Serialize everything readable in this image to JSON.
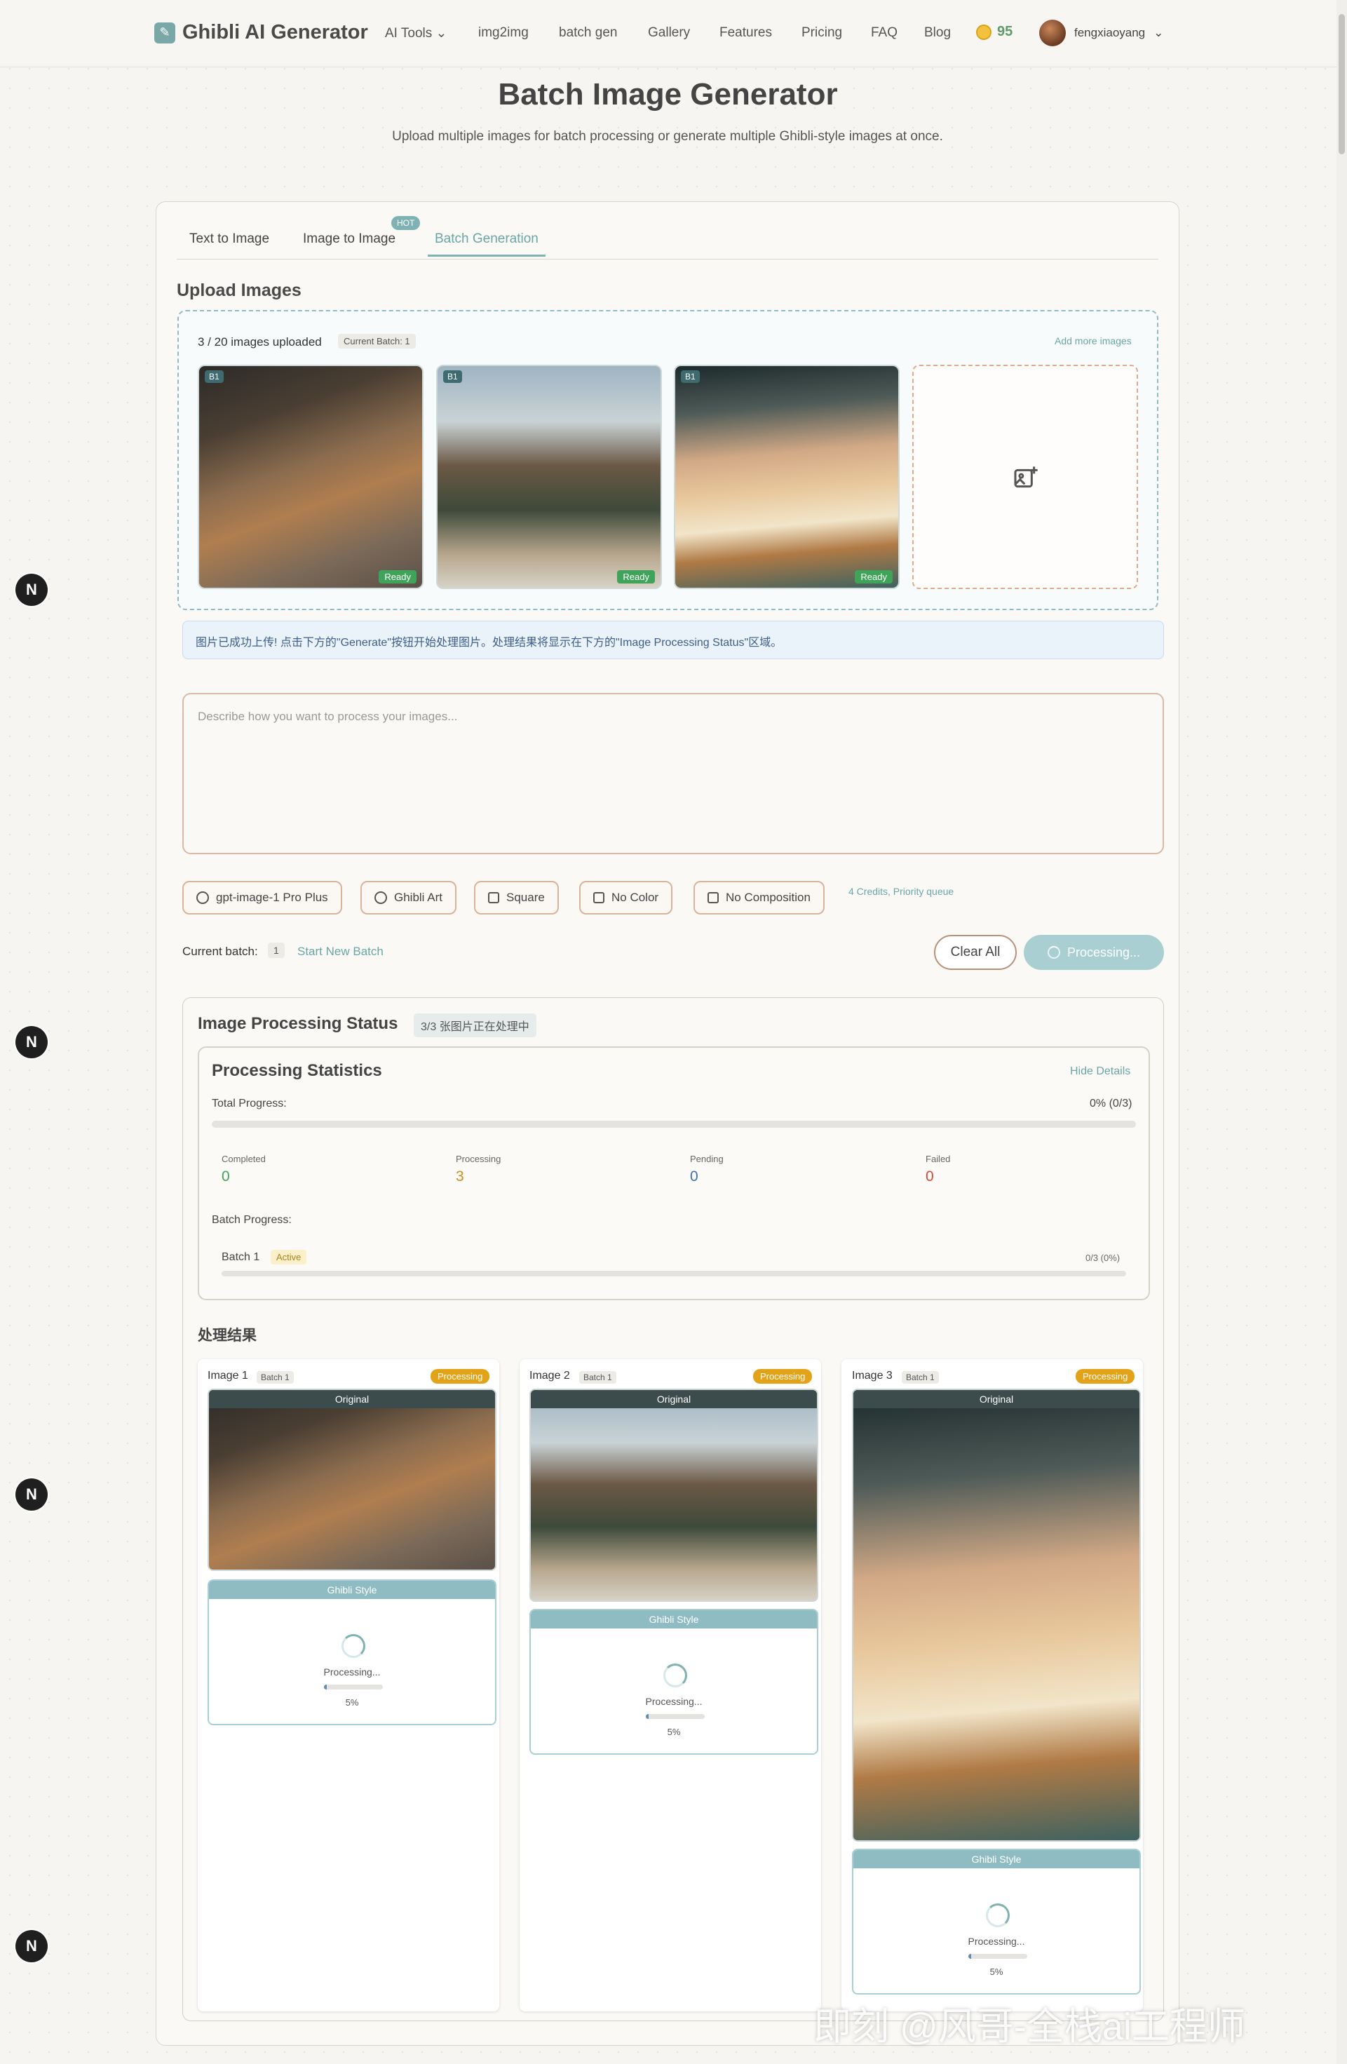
{
  "nav": {
    "logo_text": "Ghibli AI Generator",
    "links": [
      "AI Tools",
      "img2img",
      "batch gen",
      "Gallery",
      "Features",
      "Pricing",
      "FAQ",
      "Blog"
    ],
    "credits": "95",
    "username": "fengxiaoyang"
  },
  "header": {
    "title": "Batch Image Generator",
    "subtitle": "Upload multiple images for batch processing or generate multiple Ghibli-style images at once."
  },
  "tabs": {
    "items": [
      "Text to Image",
      "Image to Image",
      "Batch Generation"
    ],
    "hot_badge": "HOT",
    "active": "Batch Generation"
  },
  "upload": {
    "heading": "Upload Images",
    "count_text": "3 / 20 images uploaded",
    "batch_chip": "Current Batch: 1",
    "add_more": "Add more images",
    "thumb_badge": "B1",
    "thumb_status": "Ready"
  },
  "notice": "图片已成功上传! 点击下方的\"Generate\"按钮开始处理图片。处理结果将显示在下方的\"Image Processing Status\"区域。",
  "prompt": {
    "placeholder": "Describe how you want to process your images..."
  },
  "options": {
    "model": "gpt-image-1 Pro Plus",
    "style": "Ghibli Art",
    "ratio": "Square",
    "color": "No Color",
    "composition": "No Composition",
    "note": "4 Credits, Priority queue"
  },
  "batch_controls": {
    "label": "Current batch:",
    "number": "1",
    "start_new": "Start New Batch",
    "clear": "Clear All",
    "processing": "Processing..."
  },
  "status": {
    "heading": "Image Processing Status",
    "chip": "3/3 张图片正在处理中",
    "stats_heading": "Processing Statistics",
    "hide_details": "Hide Details",
    "total_label": "Total Progress:",
    "total_value": "0% (0/3)",
    "total_fraction": 0,
    "completed_label": "Completed",
    "completed": "0",
    "processing_label": "Processing",
    "processing": "3",
    "pending_label": "Pending",
    "pending": "0",
    "failed_label": "Failed",
    "failed": "0",
    "batch_progress_label": "Batch Progress:",
    "batch_name": "Batch 1",
    "batch_state": "Active",
    "batch_value": "0/3 (0%)",
    "batch_fraction": 0
  },
  "results": {
    "heading": "处理结果",
    "items": [
      {
        "name": "Image 1",
        "batch": "Batch 1",
        "status": "Processing",
        "original": "Original",
        "style": "Ghibli Style",
        "progress_text": "Processing...",
        "percent": "5%",
        "fraction": 0.05
      },
      {
        "name": "Image 2",
        "batch": "Batch 1",
        "status": "Processing",
        "original": "Original",
        "style": "Ghibli Style",
        "progress_text": "Processing...",
        "percent": "5%",
        "fraction": 0.05
      },
      {
        "name": "Image 3",
        "batch": "Batch 1",
        "status": "Processing",
        "original": "Original",
        "style": "Ghibli Style",
        "progress_text": "Processing...",
        "percent": "5%",
        "fraction": 0.05
      }
    ]
  },
  "side_badge": "N",
  "watermark": "即刻 @风哥-全栈ai工程师",
  "colors": {
    "accent": "#7fb2b2",
    "processing_badge": "#e3a318",
    "completed": "#3fa35a",
    "pending": "#3d6fb5",
    "failed": "#d04a3c"
  }
}
